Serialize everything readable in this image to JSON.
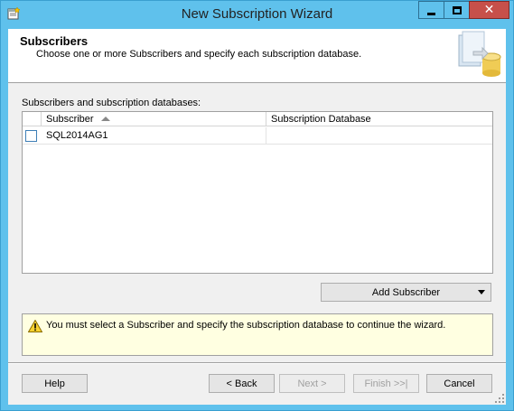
{
  "window": {
    "title": "New Subscription Wizard",
    "icon": "wizard-app-icon",
    "controls": [
      "minimize-icon",
      "maximize-icon",
      "close-icon"
    ]
  },
  "header": {
    "title": "Subscribers",
    "subtitle": "Choose one or more Subscribers and specify each subscription database.",
    "graphic": "database-wizard-graphic"
  },
  "subscribers": {
    "label": "Subscribers and subscription databases:",
    "columns": [
      "Subscriber",
      "Subscription Database"
    ],
    "sort_indicator": "ascending",
    "rows": [
      {
        "checked": false,
        "subscriber": "SQL2014AG1",
        "database": ""
      }
    ]
  },
  "add_subscriber": {
    "label": "Add Subscriber"
  },
  "message": {
    "icon": "warning-icon",
    "text": "You must select a Subscriber and specify the subscription database to continue the wizard."
  },
  "buttons": {
    "help": "Help",
    "back": "< Back",
    "next": "Next >",
    "finish": "Finish >>|",
    "cancel": "Cancel"
  },
  "colors": {
    "title_bar": "#5fc1ec",
    "close_button": "#c7504a",
    "message_background": "#ffffe1",
    "checkbox_border": "#3e7fb6"
  }
}
